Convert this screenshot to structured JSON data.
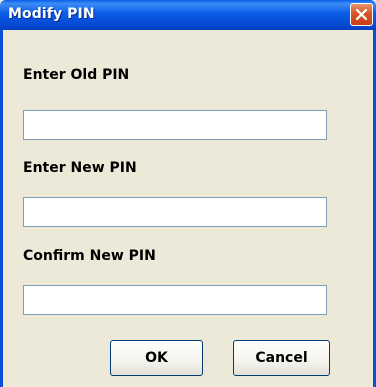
{
  "window": {
    "title": "Modify PIN"
  },
  "form": {
    "old_pin_label": "Enter Old PIN",
    "old_pin_value": "",
    "new_pin_label": "Enter New PIN",
    "new_pin_value": "",
    "confirm_pin_label": "Confirm New PIN",
    "confirm_pin_value": ""
  },
  "buttons": {
    "ok_label": "OK",
    "cancel_label": "Cancel"
  },
  "icons": {
    "close": "close-icon"
  },
  "colors": {
    "titlebar": "#0b5ce7",
    "close_button": "#d6532a",
    "dialog_background": "#ece9d8",
    "field_border": "#7f9db9"
  }
}
